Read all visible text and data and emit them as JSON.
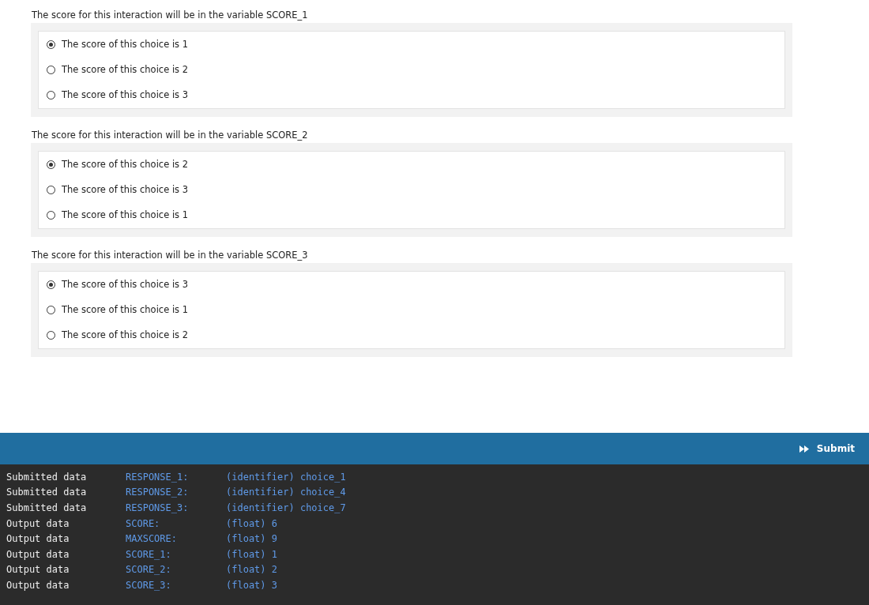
{
  "interactions": [
    {
      "prompt": "The score for this interaction will be in the variable SCORE_1",
      "choices": [
        {
          "label": "The score of this choice is 1",
          "selected": true
        },
        {
          "label": "The score of this choice is 2",
          "selected": false
        },
        {
          "label": "The score of this choice is 3",
          "selected": false
        }
      ]
    },
    {
      "prompt": "The score for this interaction will be in the variable SCORE_2",
      "choices": [
        {
          "label": "The score of this choice is 2",
          "selected": true
        },
        {
          "label": "The score of this choice is 3",
          "selected": false
        },
        {
          "label": "The score of this choice is 1",
          "selected": false
        }
      ]
    },
    {
      "prompt": "The score for this interaction will be in the variable SCORE_3",
      "choices": [
        {
          "label": "The score of this choice is 3",
          "selected": true
        },
        {
          "label": "The score of this choice is 1",
          "selected": false
        },
        {
          "label": "The score of this choice is 2",
          "selected": false
        }
      ]
    }
  ],
  "submit_button": {
    "label": "Submit"
  },
  "console": [
    {
      "kind": "Submitted data",
      "variable": "RESPONSE_1:",
      "value": "(identifier) choice_1"
    },
    {
      "kind": "Submitted data",
      "variable": "RESPONSE_2:",
      "value": "(identifier) choice_4"
    },
    {
      "kind": "Submitted data",
      "variable": "RESPONSE_3:",
      "value": "(identifier) choice_7"
    },
    {
      "kind": "Output data",
      "variable": "SCORE:",
      "value": "(float) 6"
    },
    {
      "kind": "Output data",
      "variable": "MAXSCORE:",
      "value": "(float) 9"
    },
    {
      "kind": "Output data",
      "variable": "SCORE_1:",
      "value": "(float) 1"
    },
    {
      "kind": "Output data",
      "variable": "SCORE_2:",
      "value": "(float) 2"
    },
    {
      "kind": "Output data",
      "variable": "SCORE_3:",
      "value": "(float) 3"
    }
  ]
}
